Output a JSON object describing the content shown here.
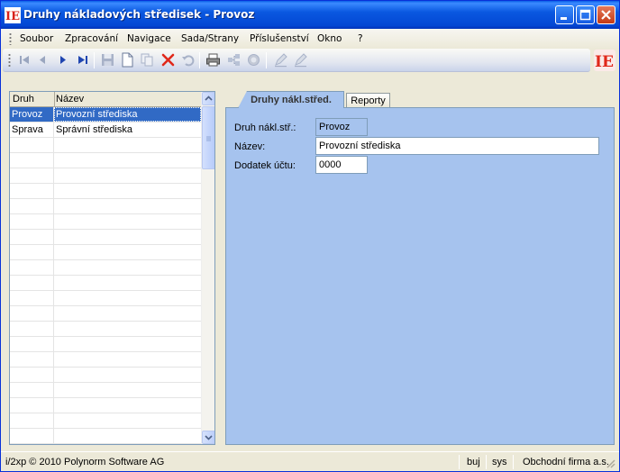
{
  "window": {
    "title": "Druhy nákladových středisek - Provoz"
  },
  "menu": {
    "items": [
      "Soubor",
      "Zpracování",
      "Navigace",
      "Sada/Strany",
      "Příslušenství",
      "Okno",
      "?"
    ]
  },
  "toolbar": {
    "icons": [
      "first-record-icon",
      "previous-record-icon",
      "next-record-icon",
      "last-record-icon",
      "save-icon",
      "new-record-icon",
      "copy-record-icon",
      "delete-icon",
      "undo-icon",
      "print-icon",
      "hierarchy-icon",
      "disabled-circle-icon",
      "edit-pen-icon",
      "edit-pen-alt-icon"
    ]
  },
  "grid": {
    "columns": [
      "Druh",
      "Název"
    ],
    "rows": [
      {
        "druh": "Provoz",
        "nazev": "Provozní střediska",
        "selected": true
      },
      {
        "druh": "Sprava",
        "nazev": "Správní střediska",
        "selected": false
      }
    ],
    "empty_rows": 20
  },
  "tabs": {
    "active": "Druhy nákl.střed.",
    "inactive": "Reporty"
  },
  "form": {
    "druh_label": "Druh nákl.stř.:",
    "druh_value": "Provoz",
    "nazev_label": "Název:",
    "nazev_value": "Provozní střediska",
    "dodatek_label": "Dodatek účtu:",
    "dodatek_value": "0000"
  },
  "status": {
    "copyright": "i/2xp © 2010 Polynorm Software AG",
    "user": "buj",
    "system": "sys",
    "company": "Obchodní firma a.s."
  },
  "colors": {
    "titlebar": "#0a58e0",
    "panel": "#a6c3ee",
    "selection": "#316ac5",
    "logo_red": "#e0281a"
  }
}
